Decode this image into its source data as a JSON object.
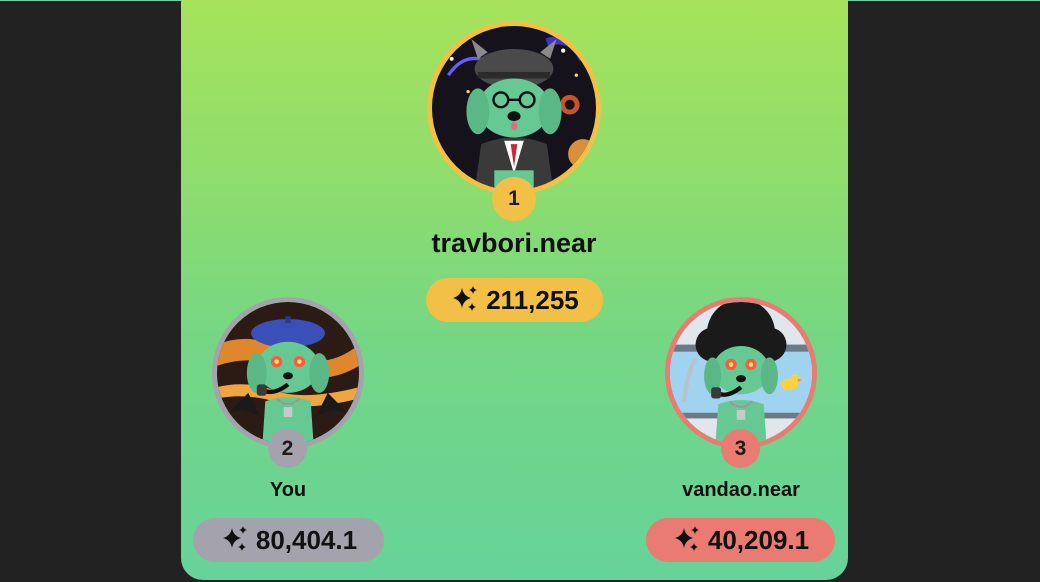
{
  "leaderboard": {
    "first": {
      "rank": "1",
      "name": "travbori.near",
      "score": "211,255",
      "color": "#f2c046"
    },
    "second": {
      "rank": "2",
      "name": "You",
      "score": "80,404.1",
      "color": "#a4a3ad"
    },
    "third": {
      "rank": "3",
      "name": "vandao.near",
      "score": "40,209.1",
      "color": "#ea7b72"
    },
    "score_icon": "sparkle-icon"
  },
  "colors": {
    "background": "#222222",
    "panel_top": "#a6e35b",
    "panel_bottom": "#66d399",
    "character": "#66c994"
  }
}
